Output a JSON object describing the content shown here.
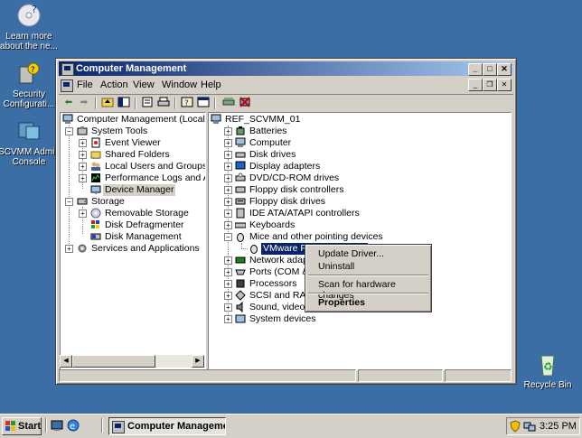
{
  "desktop": {
    "icons": [
      {
        "label": "Learn more about the ne..."
      },
      {
        "label": "Security Configurati..."
      },
      {
        "label": "SCVMM Admin Console"
      },
      {
        "label": "Recycle Bin"
      }
    ]
  },
  "window": {
    "title": "Computer Management",
    "menu": [
      "File",
      "Action",
      "View",
      "Window",
      "Help"
    ]
  },
  "left_tree": [
    {
      "label": "Computer Management (Local)"
    },
    {
      "label": "System Tools"
    },
    {
      "label": "Event Viewer"
    },
    {
      "label": "Shared Folders"
    },
    {
      "label": "Local Users and Groups"
    },
    {
      "label": "Performance Logs and Alerts"
    },
    {
      "label": "Device Manager"
    },
    {
      "label": "Storage"
    },
    {
      "label": "Removable Storage"
    },
    {
      "label": "Disk Defragmenter"
    },
    {
      "label": "Disk Management"
    },
    {
      "label": "Services and Applications"
    }
  ],
  "right_tree": {
    "root": "REF_SCVMM_01",
    "items": [
      "Batteries",
      "Computer",
      "Disk drives",
      "Display adapters",
      "DVD/CD-ROM drives",
      "Floppy disk controllers",
      "Floppy disk drives",
      "IDE ATA/ATAPI controllers",
      "Keyboards",
      "Mice and other pointing devices",
      "VMware Pointing Device",
      "Network adapters",
      "Ports (COM & LPT)",
      "Processors",
      "SCSI and RAID controllers",
      "Sound, video and game controllers",
      "System devices"
    ]
  },
  "context_menu": {
    "items": [
      "Update Driver...",
      "Uninstall",
      "Scan for hardware changes",
      "Properties"
    ]
  },
  "taskbar": {
    "start_label": "Start",
    "task_label": "Computer Manageme...",
    "clock": "3:25 PM"
  },
  "colors": {
    "desktop": "#3a6ea5",
    "title_active": "#0a246a",
    "face": "#d4d0c8"
  }
}
